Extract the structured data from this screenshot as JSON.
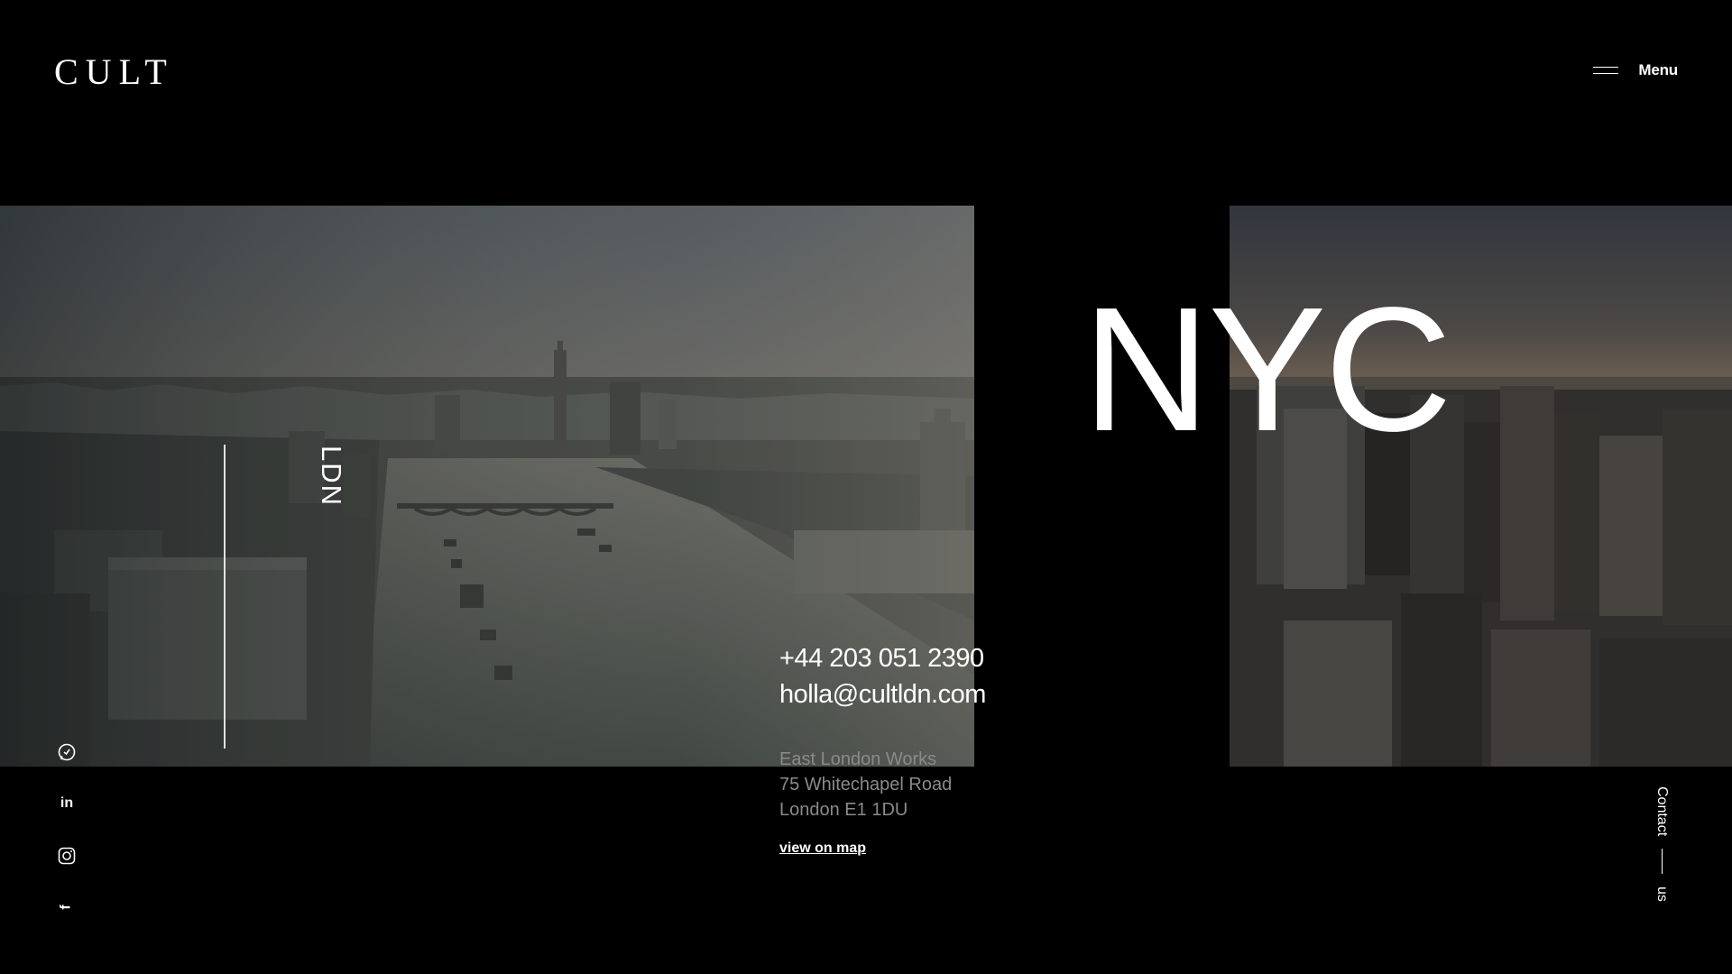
{
  "header": {
    "logo": "CULT",
    "menu_label": "Menu"
  },
  "ldn": {
    "label": "LDN",
    "phone": "+44 203 051 2390",
    "email": "holla@cultldn.com",
    "address": [
      "East London Works",
      "75 Whitechapel Road",
      "London E1 1DU"
    ],
    "map_link": "view on map"
  },
  "nyc": {
    "title": "NYC"
  },
  "social": [
    {
      "name": "whatsapp-icon"
    },
    {
      "name": "linkedin-icon",
      "glyph": "in"
    },
    {
      "name": "instagram-icon"
    },
    {
      "name": "facebook-icon",
      "glyph": "f"
    }
  ],
  "contact_us": {
    "word1": "Contact",
    "word2": "us"
  },
  "colors": {
    "background": "#000000",
    "text": "#ffffff",
    "muted": "#8a8a8a"
  }
}
